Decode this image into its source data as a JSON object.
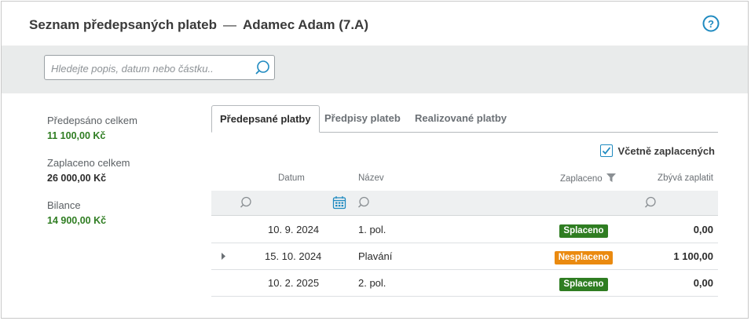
{
  "header": {
    "title": "Seznam předepsaných plateb",
    "separator": "—",
    "student": "Adamec Adam (7.A)"
  },
  "search": {
    "placeholder": "Hledejte popis, datum nebo částku..",
    "value": ""
  },
  "summary": {
    "prescribed_label": "Předepsáno celkem",
    "prescribed_value": "11 100,00 Kč",
    "paid_label": "Zaplaceno celkem",
    "paid_value": "26 000,00 Kč",
    "balance_label": "Bilance",
    "balance_value": "14 900,00 Kč"
  },
  "tabs": [
    {
      "label": "Předepsané platby",
      "active": true
    },
    {
      "label": "Předpisy plateb",
      "active": false
    },
    {
      "label": "Realizované platby",
      "active": false
    }
  ],
  "include_paid": {
    "label": "Včetně zaplacených",
    "checked": true
  },
  "table": {
    "headers": {
      "date": "Datum",
      "name": "Název",
      "paid": "Zaplaceno",
      "remaining": "Zbývá zaplatit"
    },
    "rows": [
      {
        "date": "10. 9. 2024",
        "name": "1. pol.",
        "status": "Splaceno",
        "remaining": "0,00"
      },
      {
        "date": "15. 10. 2024",
        "name": "Plavání",
        "status": "Nesplaceno",
        "remaining": "1 100,00"
      },
      {
        "date": "10. 2. 2025",
        "name": "2. pol.",
        "status": "Splaceno",
        "remaining": "0,00"
      }
    ]
  },
  "colors": {
    "accent": "#1f8ac0",
    "paid_badge": "#2f7d22",
    "unpaid_badge": "#ea8a10",
    "green_text": "#2f7d22"
  },
  "icons": {
    "help": "help-circle-icon",
    "search": "search-icon",
    "calendar": "calendar-icon",
    "filter": "funnel-icon",
    "expand": "caret-right-icon",
    "check": "check-icon"
  }
}
